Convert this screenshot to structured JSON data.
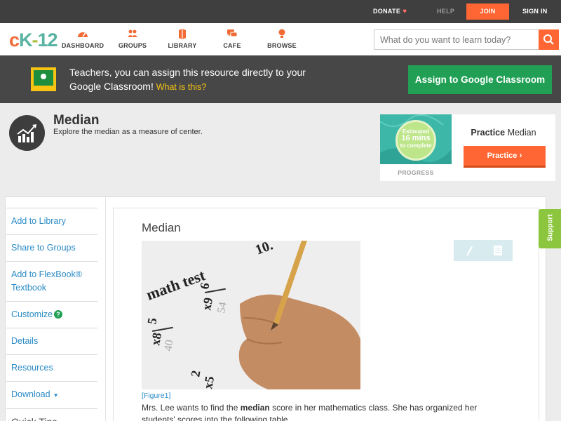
{
  "topbar": {
    "donate": "DONATE",
    "help": "HELP",
    "join": "JOIN",
    "signin": "SIGN IN"
  },
  "logo": {
    "c": "c",
    "k": "K",
    "dash": "-",
    "num": "12"
  },
  "nav": {
    "items": [
      {
        "label": "DASHBOARD",
        "icon": "dashboard-icon"
      },
      {
        "label": "GROUPS",
        "icon": "groups-icon"
      },
      {
        "label": "LIBRARY",
        "icon": "library-icon"
      },
      {
        "label": "CAFE",
        "icon": "cafe-icon"
      },
      {
        "label": "BROWSE",
        "icon": "browse-icon"
      }
    ],
    "search_placeholder": "What do you want to learn today?"
  },
  "banner": {
    "text": "Teachers, you can assign this resource directly to your Google Classroom!",
    "what": "What is this?",
    "assign_button": "Assign to Google Classroom"
  },
  "concept": {
    "title": "Median",
    "description": "Explore the median as a measure of center."
  },
  "practice": {
    "estimated": "Estimated",
    "minutes": "16 mins",
    "to_complete": "to complete",
    "progress_label": "PROGRESS",
    "title_bold": "Practice",
    "title_rest": "Median",
    "button": "Practice"
  },
  "sidebar": {
    "items": [
      {
        "label": "Add to Library"
      },
      {
        "label": "Share to Groups"
      },
      {
        "label": "Add to FlexBook® Textbook"
      },
      {
        "label": "Customize"
      },
      {
        "label": "Details"
      },
      {
        "label": "Resources"
      },
      {
        "label": "Download"
      }
    ],
    "quick_tips": "Quick Tips"
  },
  "content": {
    "title": "Median",
    "figure_caption": "[Figure1]",
    "figure_text": {
      "math_test": "math test",
      "n10": "10.",
      "n6": "6",
      "x9": "x9",
      "n54": "54",
      "n5": "5",
      "x8": "x8",
      "n40": "40",
      "n2": "2",
      "x5": "x5",
      "n6b": "6"
    },
    "para_before": "Mrs. Lee wants to find the ",
    "para_bold": "median",
    "para_after": " score in her mathematics class. She has organized her students' scores into the following table."
  },
  "support": "Support",
  "colors": {
    "accent": "#ff6633",
    "link": "#2b8bc6",
    "green": "#21a055"
  }
}
